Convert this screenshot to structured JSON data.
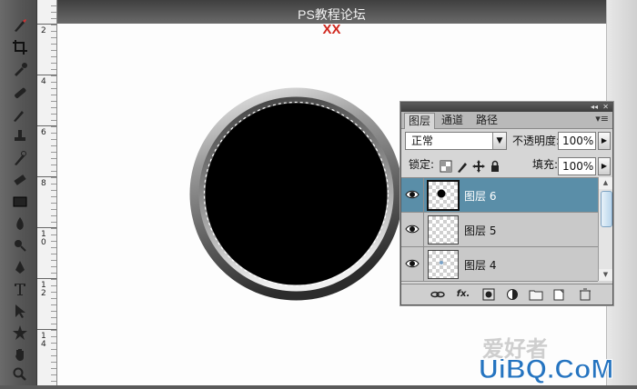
{
  "canvas": {
    "title": "PS教程论坛",
    "subtitle": "XX"
  },
  "ruler": {
    "marks": [
      "2",
      "4",
      "6",
      "8",
      "10",
      "12",
      "14"
    ]
  },
  "toolbar": {
    "tools": [
      "brush-tool",
      "crop-tool",
      "eyedropper-tool",
      "healing-tool",
      "brush-tool-2",
      "clone-stamp-tool",
      "history-brush-tool",
      "eraser-tool",
      "gradient-tool",
      "blur-tool",
      "dodge-tool",
      "pen-tool",
      "type-tool",
      "path-selection-tool",
      "custom-shape-tool",
      "hand-tool",
      "zoom-tool"
    ]
  },
  "layers_panel": {
    "tabs": [
      "图层",
      "通道",
      "路径"
    ],
    "active_tab": "图层",
    "blend_mode": "正常",
    "opacity_label": "不透明度:",
    "opacity_value": "100%",
    "lock_label": "锁定:",
    "fill_label": "填充:",
    "fill_value": "100%",
    "layers": [
      {
        "name": "图层 6",
        "selected": true
      },
      {
        "name": "图层 5",
        "selected": false
      },
      {
        "name": "图层 4",
        "selected": false
      }
    ],
    "bottom_icons": [
      "link-icon",
      "fx-icon",
      "mask-icon",
      "adjustment-icon",
      "folder-icon",
      "new-layer-icon",
      "trash-icon"
    ],
    "fx_label": "fx."
  },
  "watermark": {
    "brand": "UiBQ.CoM",
    "cn": "爱好者"
  },
  "colors": {
    "selected_layer": "#5a8ea8",
    "subtitle": "#d0261d",
    "watermark_brand": "#2574c0"
  }
}
